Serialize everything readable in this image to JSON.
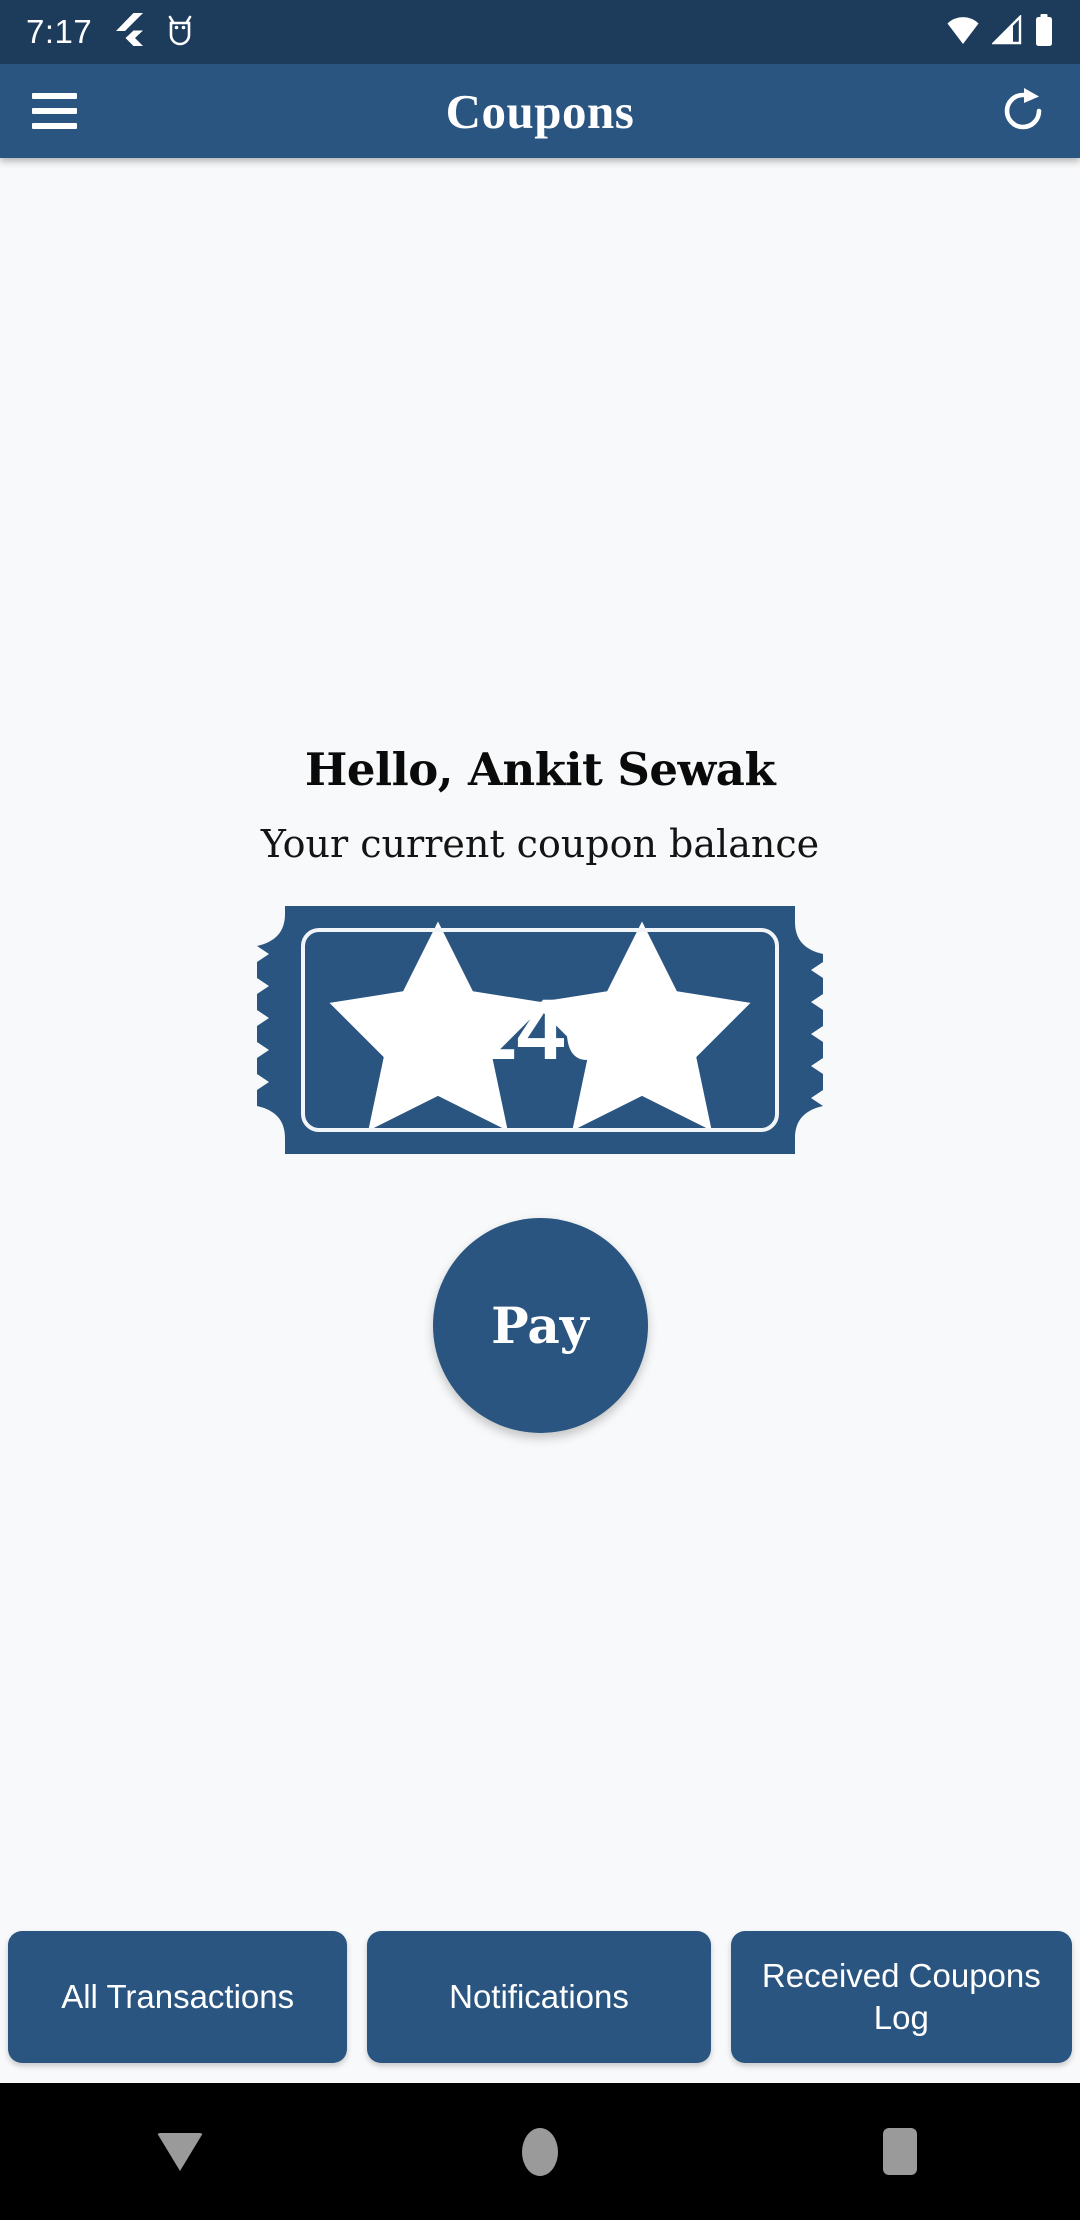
{
  "status_bar": {
    "time": "7:17",
    "left_icons": [
      "flutter-icon",
      "android-robot-icon"
    ],
    "right_icons": [
      "wifi-icon",
      "cellular-signal-icon",
      "battery-icon"
    ],
    "background_color": "#1d3c5c"
  },
  "app_bar": {
    "title": "Coupons",
    "menu_icon": "hamburger-menu-icon",
    "action_icon": "refresh-icon",
    "background_color": "#2a5580"
  },
  "main": {
    "greeting": "Hello, Ankit Sewak",
    "subtitle": "Your current coupon balance",
    "coupon": {
      "value": "240",
      "decor_icons": [
        "star-icon",
        "star-icon"
      ],
      "color": "#2a5580"
    },
    "pay_button": {
      "label": "Pay",
      "color": "#2a5580"
    },
    "background_color": "#f8f9fa"
  },
  "bottom_nav": {
    "buttons": [
      {
        "label": "All Transactions"
      },
      {
        "label": "Notifications"
      },
      {
        "label": "Received Coupons Log"
      }
    ],
    "color": "#2a5580"
  },
  "system_nav": {
    "background_color": "#000000",
    "buttons": [
      "back-button",
      "home-button",
      "recents-button"
    ]
  }
}
